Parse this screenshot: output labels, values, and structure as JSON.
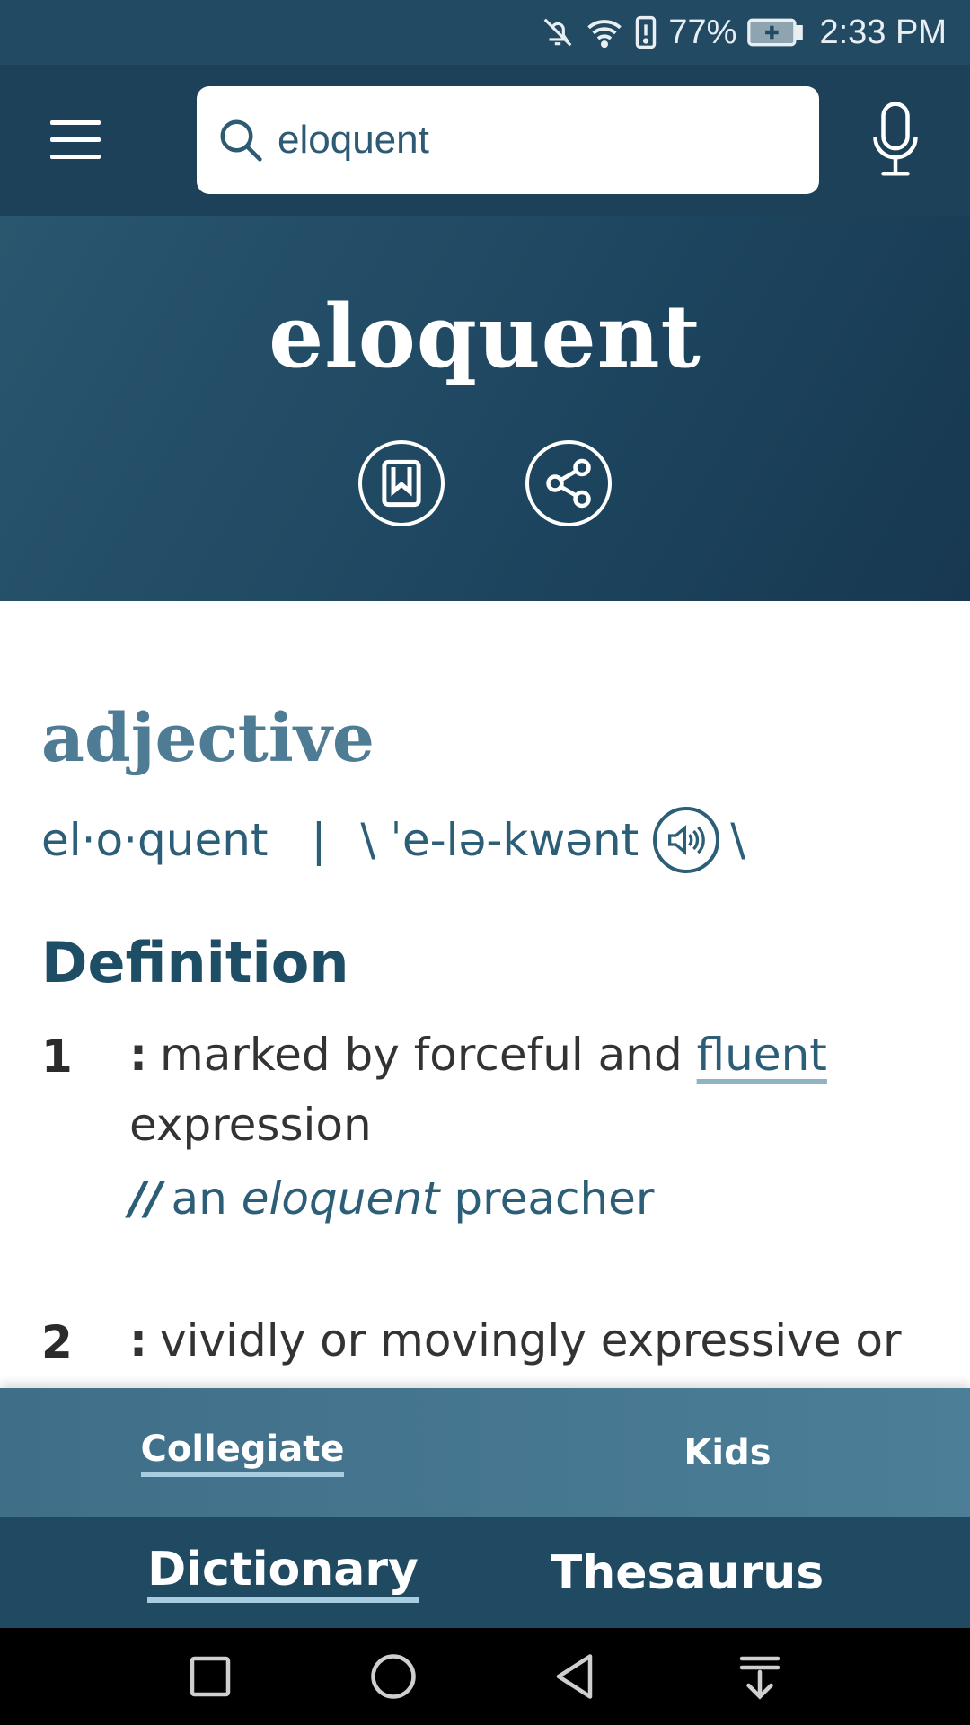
{
  "status_bar": {
    "battery_percent": "77%",
    "time": "2:33 PM",
    "icons": [
      "mute-icon",
      "wifi-icon",
      "alert-icon",
      "battery-charging-icon"
    ]
  },
  "app_bar": {
    "search_value": "eloquent",
    "icons": [
      "menu-icon",
      "search-icon",
      "microphone-icon"
    ]
  },
  "hero": {
    "headword": "eloquent",
    "icons": [
      "bookmark-icon",
      "share-icon"
    ]
  },
  "entry": {
    "part_of_speech": "adjective",
    "syllables": "el·o·quent",
    "separator": "|",
    "pron_open": "\\ ˈe-lə-kwənt",
    "pron_close": "\\",
    "definition_heading": "Definition",
    "senses": [
      {
        "number": "1",
        "colon": ":",
        "text_before": "marked by forceful and ",
        "link": "fluent",
        "text_after": " expression",
        "example_slashes": "//",
        "example_pre": "an ",
        "example_word": "eloquent",
        "example_post": " preacher"
      },
      {
        "number": "2",
        "colon": ":",
        "text": "vividly or movingly expressive or"
      }
    ]
  },
  "sub_tabs": {
    "collegiate": "Collegiate",
    "kids": "Kids",
    "active": "Collegiate"
  },
  "main_tabs": {
    "dictionary": "Dictionary",
    "thesaurus": "Thesaurus",
    "active": "Dictionary"
  },
  "colors": {
    "header_dark": "#1d4159",
    "accent_blue": "#4f7c95",
    "link_blue": "#2d5e77",
    "tab_bar": "#4c7e98",
    "underline": "#a9cde0"
  }
}
